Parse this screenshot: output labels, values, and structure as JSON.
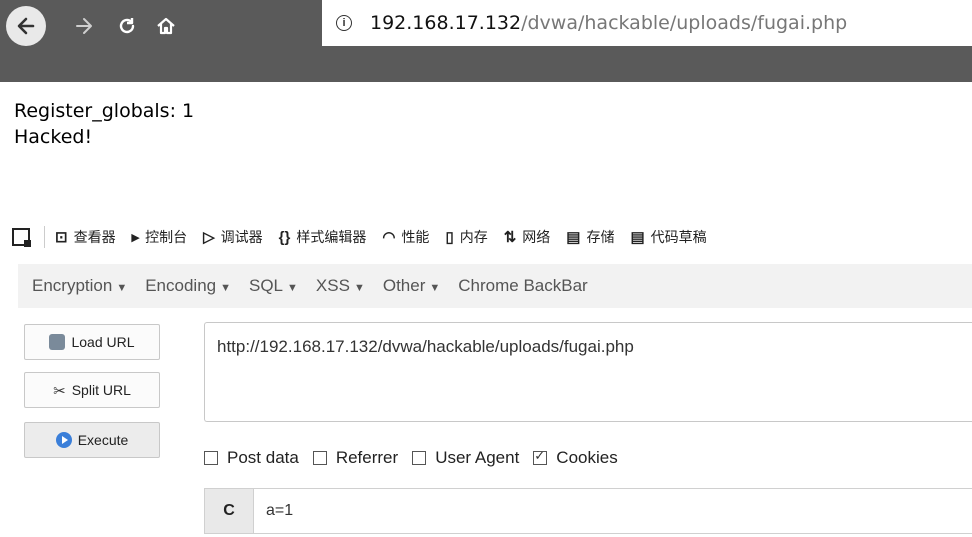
{
  "browser": {
    "url_host": "192.168.17.132",
    "url_path": "/dvwa/hackable/uploads/fugai.php"
  },
  "page": {
    "line1": "Register_globals: 1",
    "line2": "Hacked!"
  },
  "devtools": {
    "tabs": [
      {
        "label": "查看器",
        "icon": "⊡"
      },
      {
        "label": "控制台",
        "icon": "▸"
      },
      {
        "label": "调试器",
        "icon": "▷"
      },
      {
        "label": "样式编辑器",
        "icon": "{}"
      },
      {
        "label": "性能",
        "icon": "◠"
      },
      {
        "label": "内存",
        "icon": "▯"
      },
      {
        "label": "网络",
        "icon": "⇅"
      },
      {
        "label": "存储",
        "icon": "▤"
      },
      {
        "label": "代码草稿",
        "icon": "▤"
      }
    ]
  },
  "hackbar": {
    "menus": [
      "Encryption",
      "Encoding",
      "SQL",
      "XSS",
      "Other"
    ],
    "chrome_backbar": "Chrome BackBar",
    "load_url": "Load URL",
    "split_url": "Split URL",
    "execute": "Execute",
    "url_value": "http://192.168.17.132/dvwa/hackable/uploads/fugai.php",
    "options": [
      {
        "label": "Post data",
        "checked": false
      },
      {
        "label": "Referrer",
        "checked": false
      },
      {
        "label": "User Agent",
        "checked": false
      },
      {
        "label": "Cookies",
        "checked": true
      }
    ],
    "cookie_label": "C",
    "cookie_value": "a=1"
  }
}
